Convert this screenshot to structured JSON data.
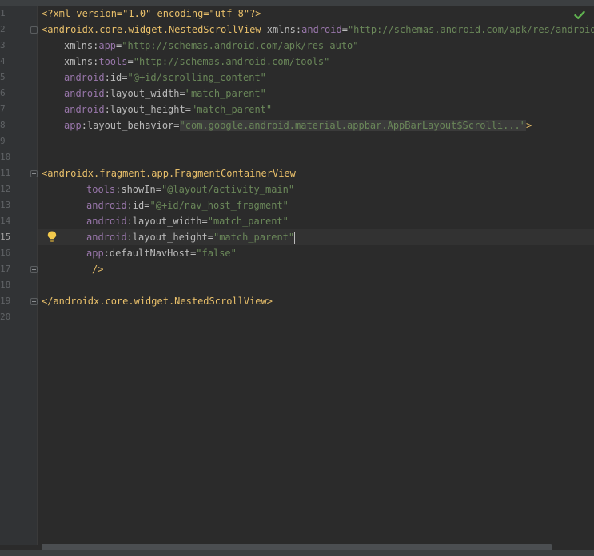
{
  "editor": {
    "language": "XML",
    "active_line": "15",
    "inspection_status": "ok",
    "icons": [
      "check-icon",
      "lightbulb-icon",
      "fold-icon"
    ],
    "colors": {
      "background": "#2b2b2b",
      "gutter": "#313335",
      "tag": "#e8bf6a",
      "attribute": "#bababa",
      "namespace": "#9876aa",
      "value": "#6a8759"
    }
  },
  "line_numbers": [
    "1",
    "2",
    "3",
    "4",
    "5",
    "6",
    "7",
    "8",
    "9",
    "10",
    "11",
    "12",
    "13",
    "14",
    "15",
    "16",
    "17",
    "18",
    "19",
    "20"
  ],
  "code": {
    "l1": {
      "decl": "<?xml version=\"1.0\" encoding=\"utf-8\"?>"
    },
    "l2": {
      "open": "<androidx.core.widget.NestedScrollView",
      "attr1": "xmlns:",
      "ns1": "android",
      "eq1": "=",
      "val1": "\"http://schemas.android.com/apk/res/android\""
    },
    "l3": {
      "attr": "xmlns:",
      "ns": "app",
      "eq": "=",
      "val": "\"http://schemas.android.com/apk/res-auto\""
    },
    "l4": {
      "attr": "xmlns:",
      "ns": "tools",
      "eq": "=",
      "val": "\"http://schemas.android.com/tools\""
    },
    "l5": {
      "ns": "android",
      "attr": ":id",
      "eq": "=",
      "val": "\"@+id/scrolling_content\""
    },
    "l6": {
      "ns": "android",
      "attr": ":layout_width",
      "eq": "=",
      "val": "\"match_parent\""
    },
    "l7": {
      "ns": "android",
      "attr": ":layout_height",
      "eq": "=",
      "val": "\"match_parent\""
    },
    "l8": {
      "ns": "app",
      "attr": ":layout_behavior",
      "eq": "=",
      "val": "\"com.google.android.material.appbar.AppBarLayout$Scrolli...\"",
      "close": ">"
    },
    "l11": {
      "open": "<androidx.fragment.app.FragmentContainerView"
    },
    "l12": {
      "ns": "tools",
      "attr": ":showIn",
      "eq": "=",
      "val": "\"@layout/activity_main\""
    },
    "l13": {
      "ns": "android",
      "attr": ":id",
      "eq": "=",
      "val": "\"@+id/nav_host_fragment\""
    },
    "l14": {
      "ns": "android",
      "attr": ":layout_width",
      "eq": "=",
      "val": "\"match_parent\""
    },
    "l15": {
      "ns": "android",
      "attr": ":layout_height",
      "eq": "=",
      "val_open": "\"",
      "val": "match_parent",
      "val_close": "\""
    },
    "l16": {
      "ns": "app",
      "attr": ":defaultNavHost",
      "eq": "=",
      "val": "\"false\""
    },
    "l17": {
      "close": "/>"
    },
    "l19": {
      "close_tag": "</androidx.core.widget.NestedScrollView>"
    }
  }
}
